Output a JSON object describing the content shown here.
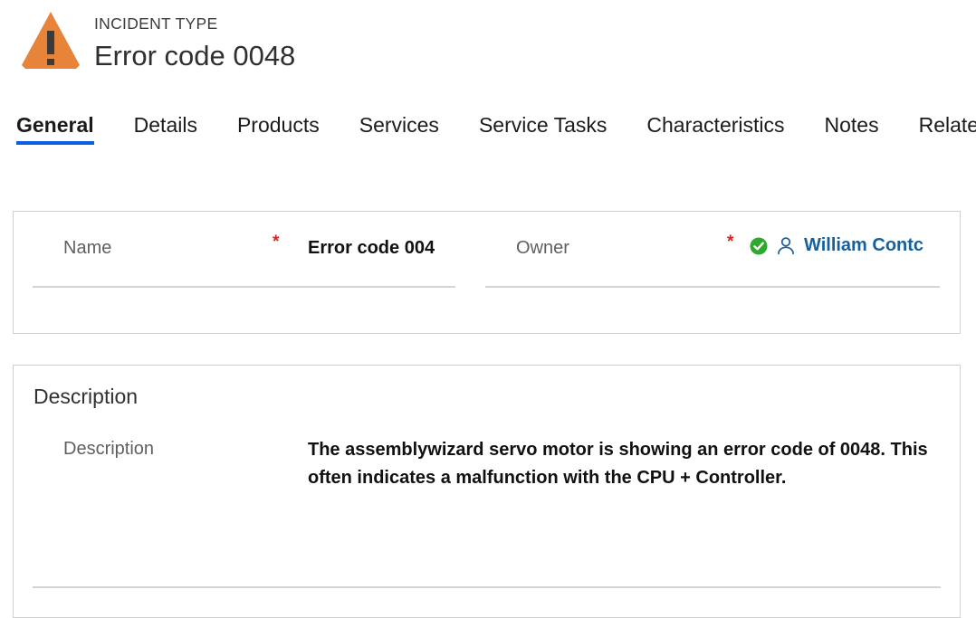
{
  "theme": {
    "accent_blue": "#0b5fe0",
    "link_blue": "#16609e",
    "warning_orange": "#e8833a",
    "required_red": "#d62424",
    "success_green": "#2ea92e",
    "card_border": "#cfcfcf",
    "rule_gray": "#d4d4d4"
  },
  "header": {
    "icon": "warning-triangle-icon",
    "entity_kind": "INCIDENT TYPE",
    "title": "Error code 0048"
  },
  "tabs": [
    {
      "label": "General",
      "active": true
    },
    {
      "label": "Details",
      "active": false
    },
    {
      "label": "Products",
      "active": false
    },
    {
      "label": "Services",
      "active": false
    },
    {
      "label": "Service Tasks",
      "active": false
    },
    {
      "label": "Characteristics",
      "active": false
    },
    {
      "label": "Notes",
      "active": false
    },
    {
      "label": "Related",
      "active": false
    }
  ],
  "general_card": {
    "name_field": {
      "label": "Name",
      "required_marker": "*",
      "value": "Error code 004"
    },
    "owner_field": {
      "label": "Owner",
      "required_marker": "*",
      "status_icon": "checkmark-circle-icon",
      "record_icon": "person-icon",
      "value": "William Contc"
    }
  },
  "description_card": {
    "section_heading": "Description",
    "description_field": {
      "label": "Description",
      "value": "The assemblywizard servo motor is showing an error code of 0048. This often indicates a malfunction with the CPU + Controller."
    }
  }
}
